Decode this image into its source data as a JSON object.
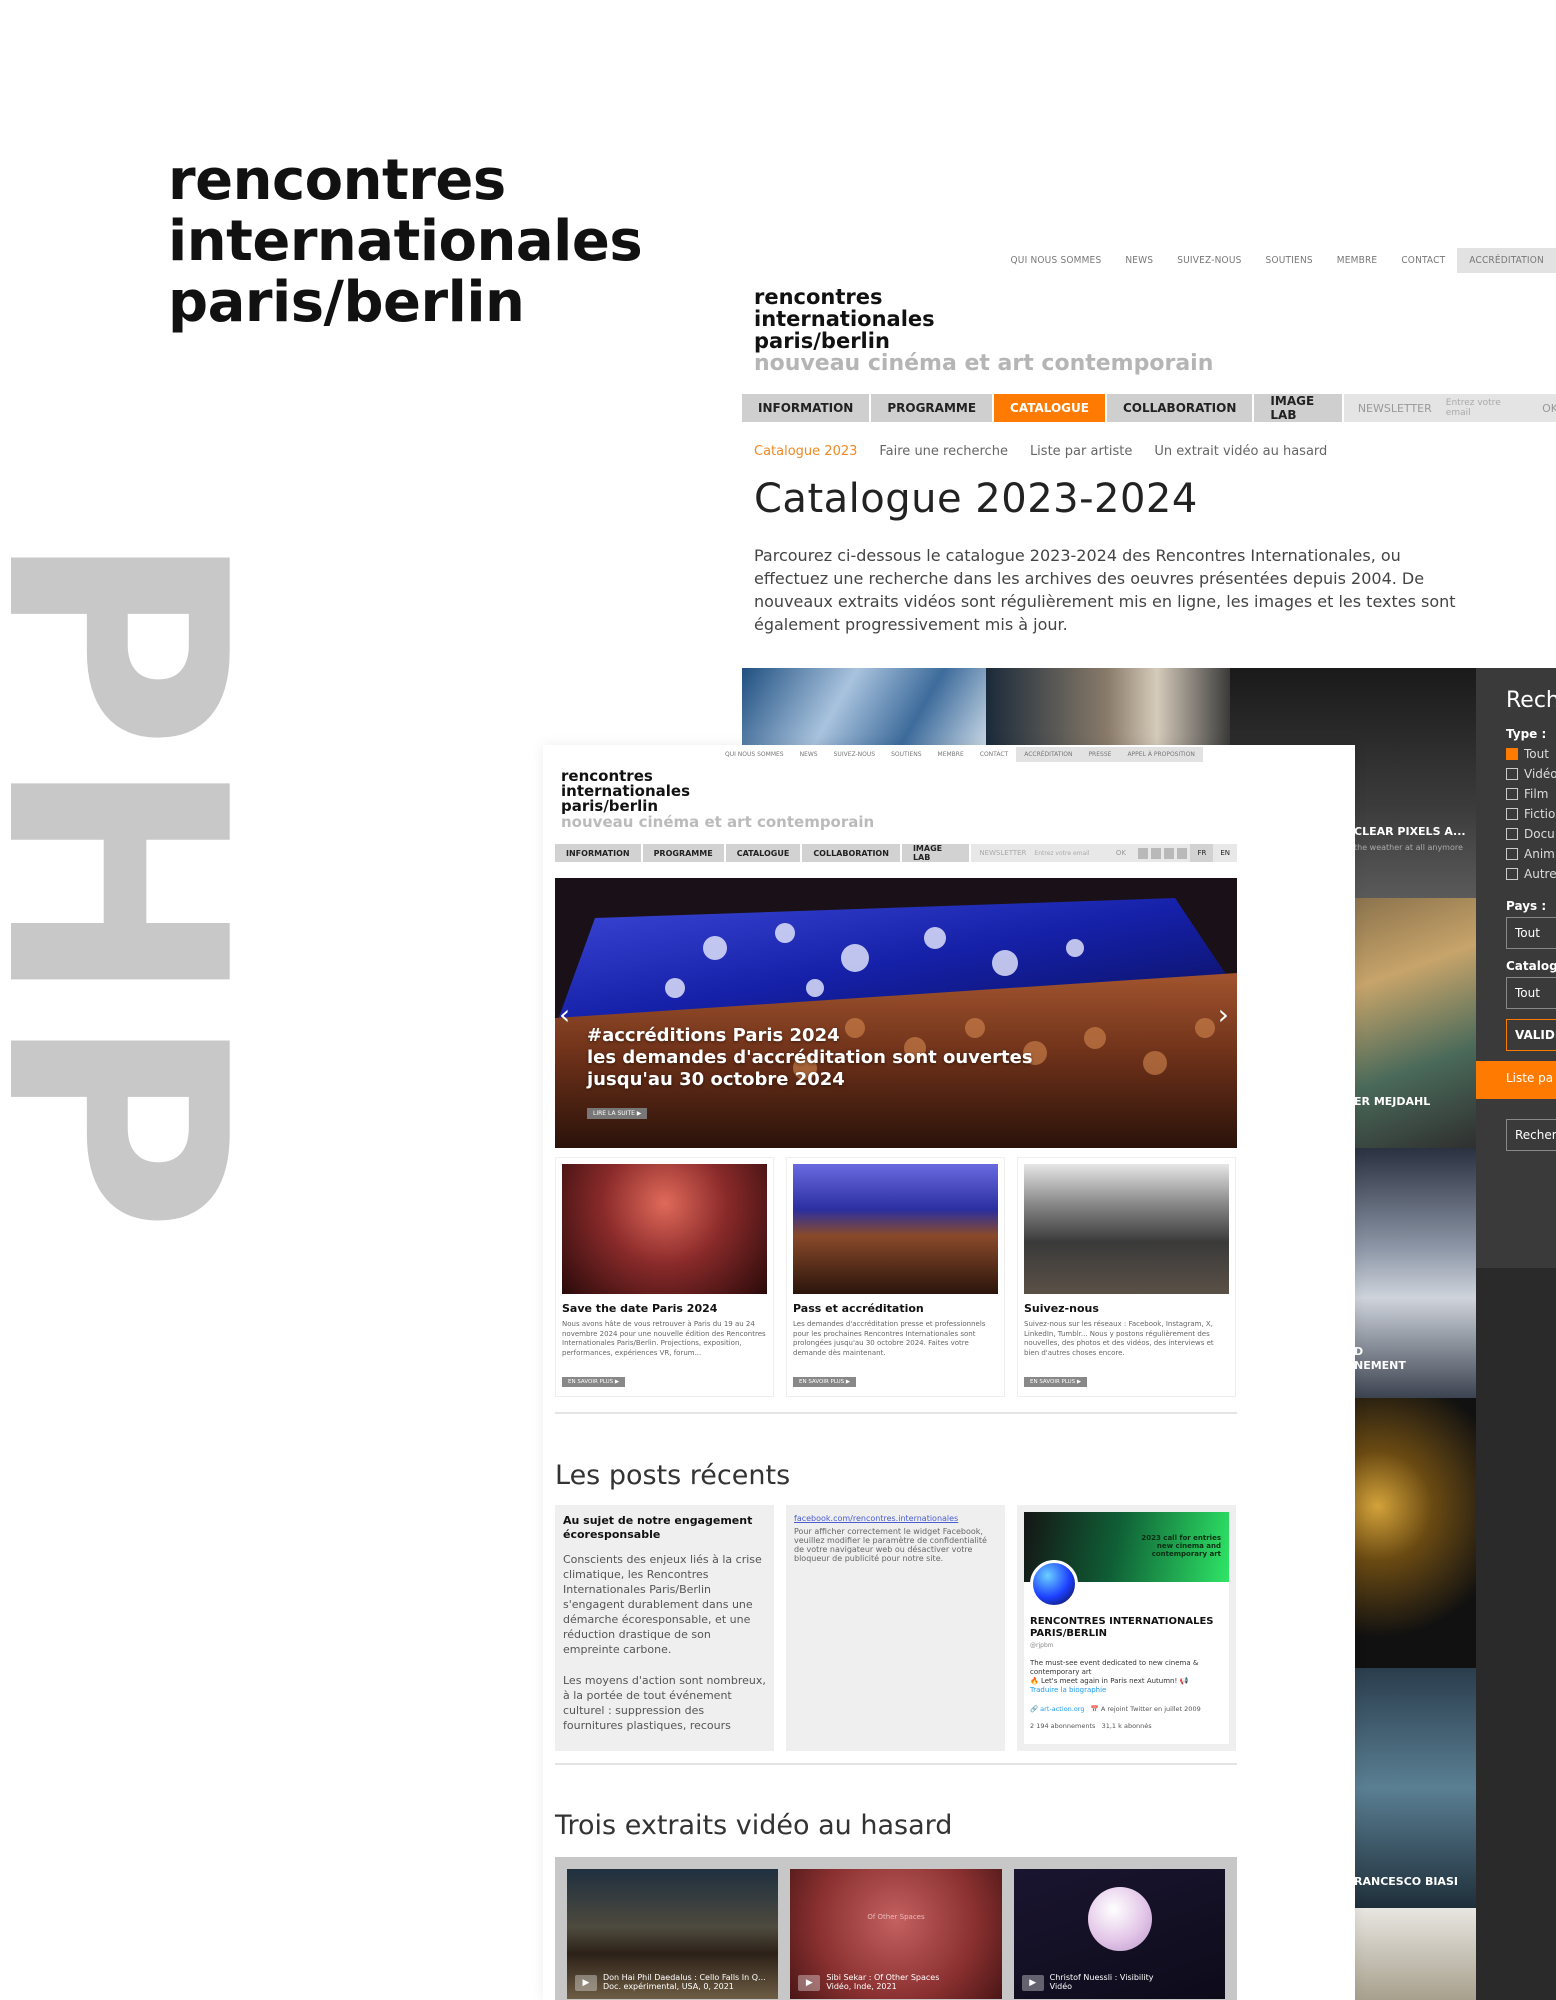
{
  "brand": {
    "title_lines": [
      "rencontres",
      "internationales",
      "paris/berlin"
    ],
    "big_letters": "PHP"
  },
  "catalogue_page": {
    "top_nav": [
      "QUI NOUS SOMMES",
      "NEWS",
      "SUIVEZ-NOUS",
      "SOUTIENS",
      "MEMBRE",
      "CONTACT",
      "ACCRÉDITATION"
    ],
    "logo_lines": [
      "rencontres",
      "internationales",
      "paris/berlin"
    ],
    "logo_sub": "nouveau cinéma et art contemporain",
    "main_nav": [
      "INFORMATION",
      "PROGRAMME",
      "CATALOGUE",
      "COLLABORATION",
      "IMAGE LAB"
    ],
    "newsletter": "NEWSLETTER",
    "newsletter_placeholder": "Entrez votre email",
    "ok": "OK",
    "sub_nav": [
      "Catalogue 2023",
      "Faire une recherche",
      "Liste par artiste",
      "Un extrait vidéo au hasard"
    ],
    "title": "Catalogue 2023-2024",
    "description": "Parcourez ci-dessous le catalogue 2023-2024 des Rencontres Internationales, ou effectuez une recherche dans les archives des oeuvres présentées depuis 2004. De nouveaux extraits vidéos sont régulièrement mis en ligne, les images et les textes sont également progressivement mis à jour.",
    "tile_captions": [
      "CLEAR PIXELS A...",
      "the weather at all anymore",
      "ER MEJDAHL",
      "D",
      "NEMENT",
      "RANCESCO BIASI"
    ],
    "search": {
      "heading": "Rech",
      "type_label": "Type :",
      "types": [
        "Tout",
        "Vidéo",
        "Film",
        "Fictio",
        "Docu",
        "Anim",
        "Autre"
      ],
      "pays_label": "Pays :",
      "pays_value": "Tout",
      "catalogue_label": "Catalogu",
      "catalogue_value": "Tout",
      "validate": "VALIDE",
      "liste": "Liste pa",
      "search_btn": "Recherc"
    }
  },
  "home_page": {
    "top_nav": [
      "QUI NOUS SOMMES",
      "NEWS",
      "SUIVEZ-NOUS",
      "SOUTIENS",
      "MEMBRE",
      "CONTACT",
      "ACCRÉDITATION",
      "PRESSE",
      "APPEL À PROPOSITION"
    ],
    "logo_lines": [
      "rencontres",
      "internationales",
      "paris/berlin"
    ],
    "logo_sub": "nouveau cinéma et art contemporain",
    "main_nav": [
      "INFORMATION",
      "PROGRAMME",
      "CATALOGUE",
      "COLLABORATION",
      "IMAGE LAB"
    ],
    "newsletter": "NEWSLETTER",
    "newsletter_placeholder": "Entrez votre email",
    "ok": "OK",
    "langs": [
      "FR",
      "EN"
    ],
    "hero": {
      "line1": "#accréditions Paris 2024",
      "line2": "les demandes d'accréditation sont ouvertes",
      "line3": "jusqu'au 30 octobre 2024",
      "more": "LIRE LA SUITE ▶"
    },
    "cards": [
      {
        "title": "Save the date Paris 2024",
        "text": "Nous avons hâte de vous retrouver à Paris du 19 au 24 novembre 2024 pour une nouvelle édition des Rencontres Internationales Paris/Berlin. Projections, exposition, performances, expériences VR, forum...",
        "button": "EN SAVOIR PLUS ▶"
      },
      {
        "title": "Pass et accréditation",
        "text": "Les demandes d'accréditation presse et professionnels pour les prochaines Rencontres Internationales sont prolongées jusqu'au 30 octobre 2024. Faites votre demande dès maintenant.",
        "button": "EN SAVOIR PLUS ▶"
      },
      {
        "title": "Suivez-nous",
        "text": "Suivez-nous sur les réseaux : Facebook, Instagram, X, LinkedIn, Tumblr... Nous y postons régulièrement des nouvelles, des photos et des vidéos, des interviews et bien d'autres choses encore.",
        "button": "EN SAVOIR PLUS ▶"
      }
    ],
    "posts_heading": "Les posts récents",
    "post_eco": {
      "title": "Au sujet de notre engagement écoresponsable",
      "p1": "Conscients des enjeux liés à la crise climatique, les Rencontres Internationales Paris/Berlin s'engagent durablement dans une démarche écoresponsable, et une réduction drastique de son empreinte carbone.",
      "p2": "Les moyens d'action sont nombreux, à la portée de tout événement culturel : suppression des fournitures plastiques, recours"
    },
    "post_fb": {
      "link": "facebook.com/rencontres.internationales",
      "text": "Pour afficher correctement le widget Facebook, veuillez modifier le paramètre de confidentialité de votre navigateur web ou désactiver votre bloqueur de publicité pour notre site."
    },
    "post_twitter": {
      "banner": "2023 call for entries\nnew cinema and\ncontemporary art",
      "name": "RENCONTRES INTERNATIONALES PARIS/BERLIN",
      "handle": "@rjpbm",
      "bio": "The must-see event dedicated to new cinema & contemporary art",
      "bio2": "🔥 Let's meet again in Paris next Autumn! 📢",
      "translate": "Traduire la biographie",
      "site": "🔗 art-action.org",
      "joined": "📅 A rejoint Twitter en juillet 2009",
      "following": "2 194 abonnements",
      "followers": "31,1 k abonnés"
    },
    "videos_heading": "Trois extraits vidéo au hasard",
    "videos": [
      {
        "line1": "Don Hai Phil Daedalus : Cello Falls In Q...",
        "line2": "Doc. expérimental, USA, 0, 2021"
      },
      {
        "line1": "Sibi Sekar : Of Other Spaces",
        "line2": "Vidéo, Inde, 2021",
        "overlay": "Of Other Spaces"
      },
      {
        "line1": "Christof Nuessli : Visibility",
        "line2": "Vidéo"
      }
    ]
  },
  "colors": {
    "accent": "#ff7a00",
    "nav_grey": "#cfcfcf",
    "big_letters": "#c8c8c8"
  }
}
